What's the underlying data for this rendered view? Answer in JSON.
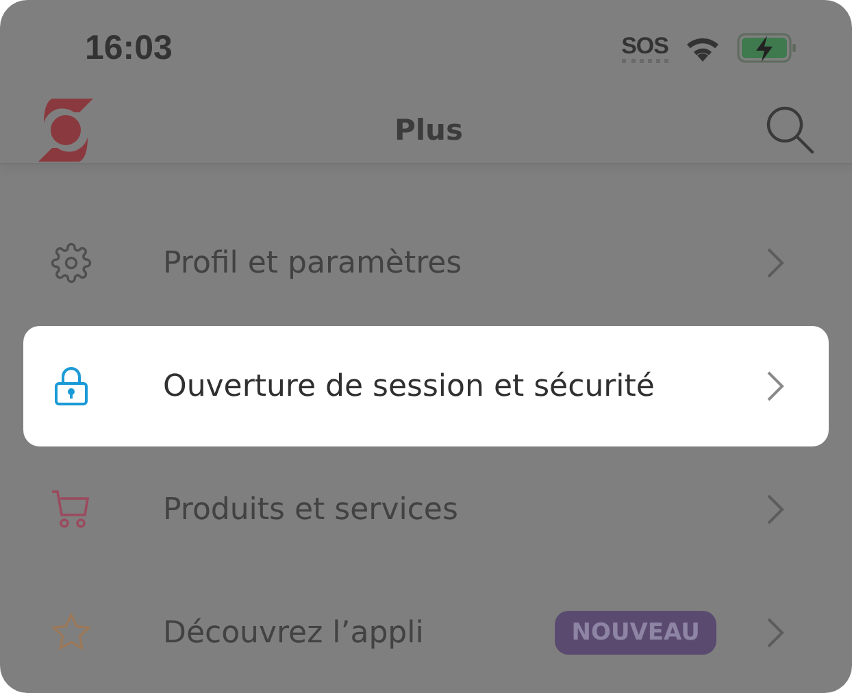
{
  "status_bar": {
    "time": "16:03",
    "sos": "SOS"
  },
  "header": {
    "title": "Plus"
  },
  "items": [
    {
      "kind": "gear",
      "label": "Profil et paramètres",
      "highlighted": false
    },
    {
      "kind": "lock",
      "label": "Ouverture de session et sécurité",
      "highlighted": true
    },
    {
      "kind": "cart",
      "label": "Produits et services",
      "highlighted": false
    },
    {
      "kind": "star",
      "label": "Découvrez l’appli",
      "highlighted": false,
      "badge": "NOUVEAU"
    }
  ]
}
